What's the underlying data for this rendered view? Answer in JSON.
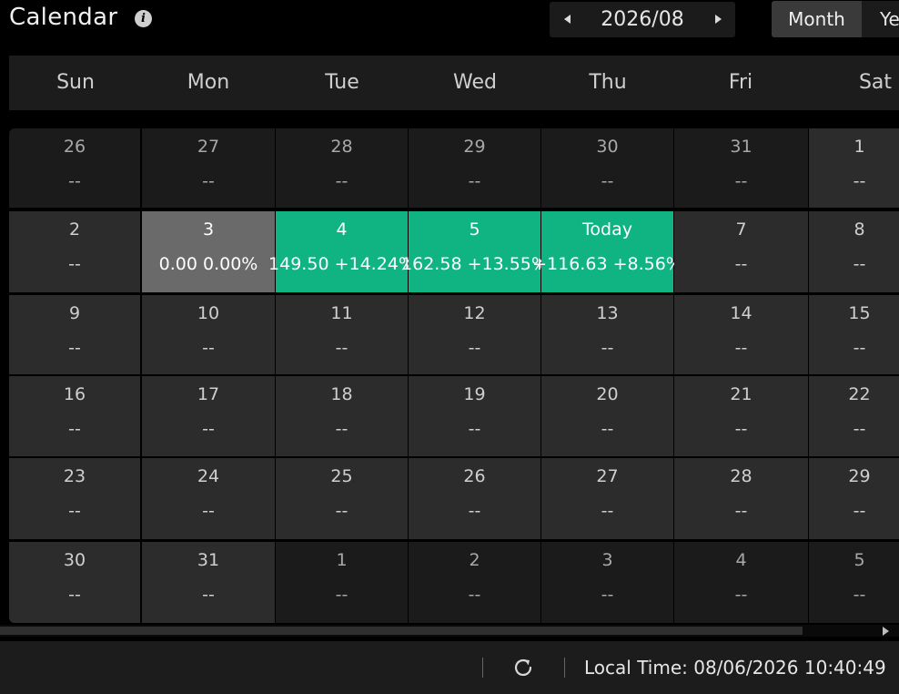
{
  "header": {
    "title": "Calendar",
    "info_icon": "info-icon",
    "month_label": "2026/08",
    "view_month": "Month",
    "view_year": "Ye"
  },
  "weekdays": [
    "Sun",
    "Mon",
    "Tue",
    "Wed",
    "Thu",
    "Fri",
    "Sat"
  ],
  "weeks": [
    [
      {
        "day": "26",
        "value": "--",
        "state": "dim"
      },
      {
        "day": "27",
        "value": "--",
        "state": "dim"
      },
      {
        "day": "28",
        "value": "--",
        "state": "dim"
      },
      {
        "day": "29",
        "value": "--",
        "state": "dim"
      },
      {
        "day": "30",
        "value": "--",
        "state": "dim"
      },
      {
        "day": "31",
        "value": "--",
        "state": "dim"
      },
      {
        "day": "1",
        "value": "--",
        "state": "sat1"
      }
    ],
    [
      {
        "day": "2",
        "value": "--",
        "state": "cur"
      },
      {
        "day": "3",
        "value": "0.00 0.00%",
        "state": "flat"
      },
      {
        "day": "4",
        "value": "149.50 +14.24%",
        "state": "gain"
      },
      {
        "day": "5",
        "value": "162.58 +13.55%",
        "state": "gain"
      },
      {
        "day": "Today",
        "value": "+116.63 +8.56%",
        "state": "gain"
      },
      {
        "day": "7",
        "value": "--",
        "state": "cur"
      },
      {
        "day": "8",
        "value": "--",
        "state": "cur"
      }
    ],
    [
      {
        "day": "9",
        "value": "--",
        "state": "cur"
      },
      {
        "day": "10",
        "value": "--",
        "state": "cur"
      },
      {
        "day": "11",
        "value": "--",
        "state": "cur"
      },
      {
        "day": "12",
        "value": "--",
        "state": "cur"
      },
      {
        "day": "13",
        "value": "--",
        "state": "cur"
      },
      {
        "day": "14",
        "value": "--",
        "state": "cur"
      },
      {
        "day": "15",
        "value": "--",
        "state": "cur"
      }
    ],
    [
      {
        "day": "16",
        "value": "--",
        "state": "cur"
      },
      {
        "day": "17",
        "value": "--",
        "state": "cur"
      },
      {
        "day": "18",
        "value": "--",
        "state": "cur"
      },
      {
        "day": "19",
        "value": "--",
        "state": "cur"
      },
      {
        "day": "20",
        "value": "--",
        "state": "cur"
      },
      {
        "day": "21",
        "value": "--",
        "state": "cur"
      },
      {
        "day": "22",
        "value": "--",
        "state": "cur"
      }
    ],
    [
      {
        "day": "23",
        "value": "--",
        "state": "cur"
      },
      {
        "day": "24",
        "value": "--",
        "state": "cur"
      },
      {
        "day": "25",
        "value": "--",
        "state": "cur"
      },
      {
        "day": "26",
        "value": "--",
        "state": "cur"
      },
      {
        "day": "27",
        "value": "--",
        "state": "cur"
      },
      {
        "day": "28",
        "value": "--",
        "state": "cur"
      },
      {
        "day": "29",
        "value": "--",
        "state": "cur"
      }
    ],
    [
      {
        "day": "30",
        "value": "--",
        "state": "cur"
      },
      {
        "day": "31",
        "value": "--",
        "state": "cur"
      },
      {
        "day": "1",
        "value": "--",
        "state": "dim"
      },
      {
        "day": "2",
        "value": "--",
        "state": "dim"
      },
      {
        "day": "3",
        "value": "--",
        "state": "dim"
      },
      {
        "day": "4",
        "value": "--",
        "state": "dim"
      },
      {
        "day": "5",
        "value": "--",
        "state": "dim"
      }
    ]
  ],
  "footer": {
    "refresh_icon": "refresh-icon",
    "local_time": "Local Time: 08/06/2026 10:40:49"
  },
  "colors": {
    "gain": "#10b482",
    "flat": "#6a6a6a",
    "background": "#000000"
  }
}
